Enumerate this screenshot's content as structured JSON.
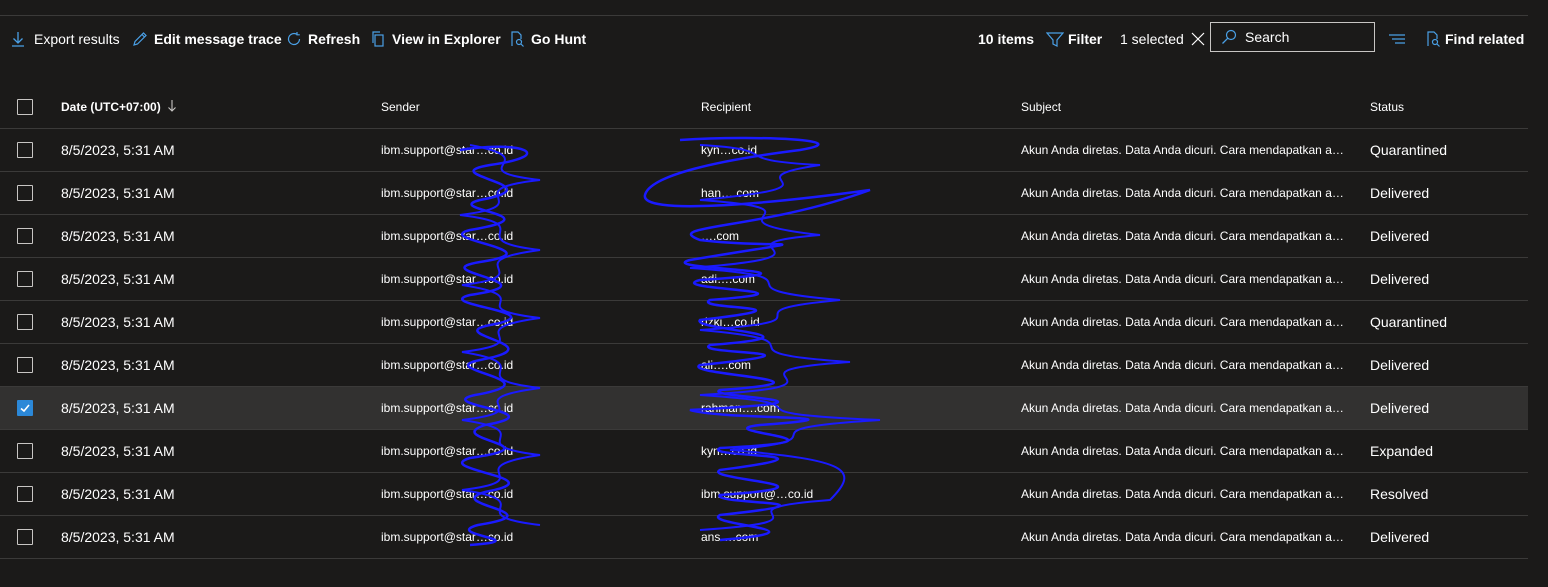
{
  "toolbar": {
    "export_label": "Export results",
    "edit_trace_label": "Edit message trace",
    "refresh_label": "Refresh",
    "view_explorer_label": "View in Explorer",
    "go_hunt_label": "Go Hunt",
    "items_count": "10 items",
    "filter_label": "Filter",
    "selected_label": "1 selected",
    "search_placeholder": "Search",
    "find_related_label": "Find related"
  },
  "table": {
    "headers": {
      "date": "Date (UTC+07:00)",
      "sender": "Sender",
      "recipient": "Recipient",
      "subject": "Subject",
      "status": "Status"
    },
    "rows": [
      {
        "date": "8/5/2023, 5:31 AM",
        "sender": "ibm.support@star…co.id",
        "recipient": "kyn…co.id",
        "subject": "Akun Anda diretas. Data Anda dicuri. Cara mendapatkan akses kembali",
        "status": "Quarantined",
        "checked": false
      },
      {
        "date": "8/5/2023, 5:31 AM",
        "sender": "ibm.support@star…co.id",
        "recipient": "han….com",
        "subject": "Akun Anda diretas. Data Anda dicuri. Cara mendapatkan akses kembali",
        "status": "Delivered",
        "checked": false
      },
      {
        "date": "8/5/2023, 5:31 AM",
        "sender": "ibm.support@star…co.id",
        "recipient": "….com",
        "subject": "Akun Anda diretas. Data Anda dicuri. Cara mendapatkan akses kembali",
        "status": "Delivered",
        "checked": false
      },
      {
        "date": "8/5/2023, 5:31 AM",
        "sender": "ibm.support@star…co.id",
        "recipient": "adi….com",
        "subject": "Akun Anda diretas. Data Anda dicuri. Cara mendapatkan akses kembali",
        "status": "Delivered",
        "checked": false
      },
      {
        "date": "8/5/2023, 5:31 AM",
        "sender": "ibm.support@star…co.id",
        "recipient": "rizki…co.id",
        "subject": "Akun Anda diretas. Data Anda dicuri. Cara mendapatkan akses kembali",
        "status": "Quarantined",
        "checked": false
      },
      {
        "date": "8/5/2023, 5:31 AM",
        "sender": "ibm.support@star…co.id",
        "recipient": "ali….com",
        "subject": "Akun Anda diretas. Data Anda dicuri. Cara mendapatkan akses kembali",
        "status": "Delivered",
        "checked": false
      },
      {
        "date": "8/5/2023, 5:31 AM",
        "sender": "ibm.support@star…co.id",
        "recipient": "rahman….com",
        "subject": "Akun Anda diretas. Data Anda dicuri. Cara mendapatkan akses kembali",
        "status": "Delivered",
        "checked": true
      },
      {
        "date": "8/5/2023, 5:31 AM",
        "sender": "ibm.support@star…co.id",
        "recipient": "kyn…co.id",
        "subject": "Akun Anda diretas. Data Anda dicuri. Cara mendapatkan akses kembali",
        "status": "Expanded",
        "checked": false
      },
      {
        "date": "8/5/2023, 5:31 AM",
        "sender": "ibm.support@star…co.id",
        "recipient": "ibm.support@…co.id",
        "subject": "Akun Anda diretas. Data Anda dicuri. Cara mendapatkan akses kembali",
        "status": "Resolved",
        "checked": false
      },
      {
        "date": "8/5/2023, 5:31 AM",
        "sender": "ibm.support@star…co.id",
        "recipient": "ans….com",
        "subject": "Akun Anda diretas. Data Anda dicuri. Cara mendapatkan akses kembali",
        "status": "Delivered",
        "checked": false
      }
    ]
  },
  "colors": {
    "background": "#1b1a19",
    "selected_row": "#323130",
    "accent": "#2b88d8",
    "redaction_scribble": "#1a1aff"
  },
  "icons": [
    "download-icon",
    "edit-icon",
    "refresh-icon",
    "copy-icon",
    "hunt-icon",
    "filter-icon",
    "close-icon",
    "search-icon",
    "group-lines-icon",
    "find-related-icon",
    "sort-down-icon",
    "checkmark-icon"
  ]
}
